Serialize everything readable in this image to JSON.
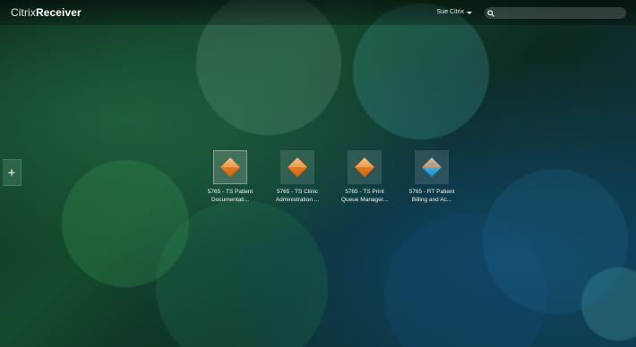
{
  "header": {
    "logo_light": "Citrix",
    "logo_bold": "Receiver",
    "user_name": "Sue Citrix",
    "search_placeholder": ""
  },
  "sidebar": {
    "add_label": "+"
  },
  "apps": [
    {
      "line1": "5765 - TS Patient",
      "line2": "Documentati...",
      "icon": "orange-diamond-icon",
      "selected": true
    },
    {
      "line1": "5765 - TS Clinic",
      "line2": "Administration ...",
      "icon": "orange-diamond-icon",
      "selected": false
    },
    {
      "line1": "5765 - TS Print",
      "line2": "Queue Manager...",
      "icon": "orange-diamond-icon",
      "selected": false
    },
    {
      "line1": "5765 - RT Patient",
      "line2": "Billing and Ac...",
      "icon": "blue-diamond-icon",
      "selected": false
    }
  ],
  "colors": {
    "orange_top": "#f2b179",
    "orange_bottom": "#e07b1f",
    "blue_top": "#d9a86a",
    "blue_bottom": "#2fa3d8"
  }
}
